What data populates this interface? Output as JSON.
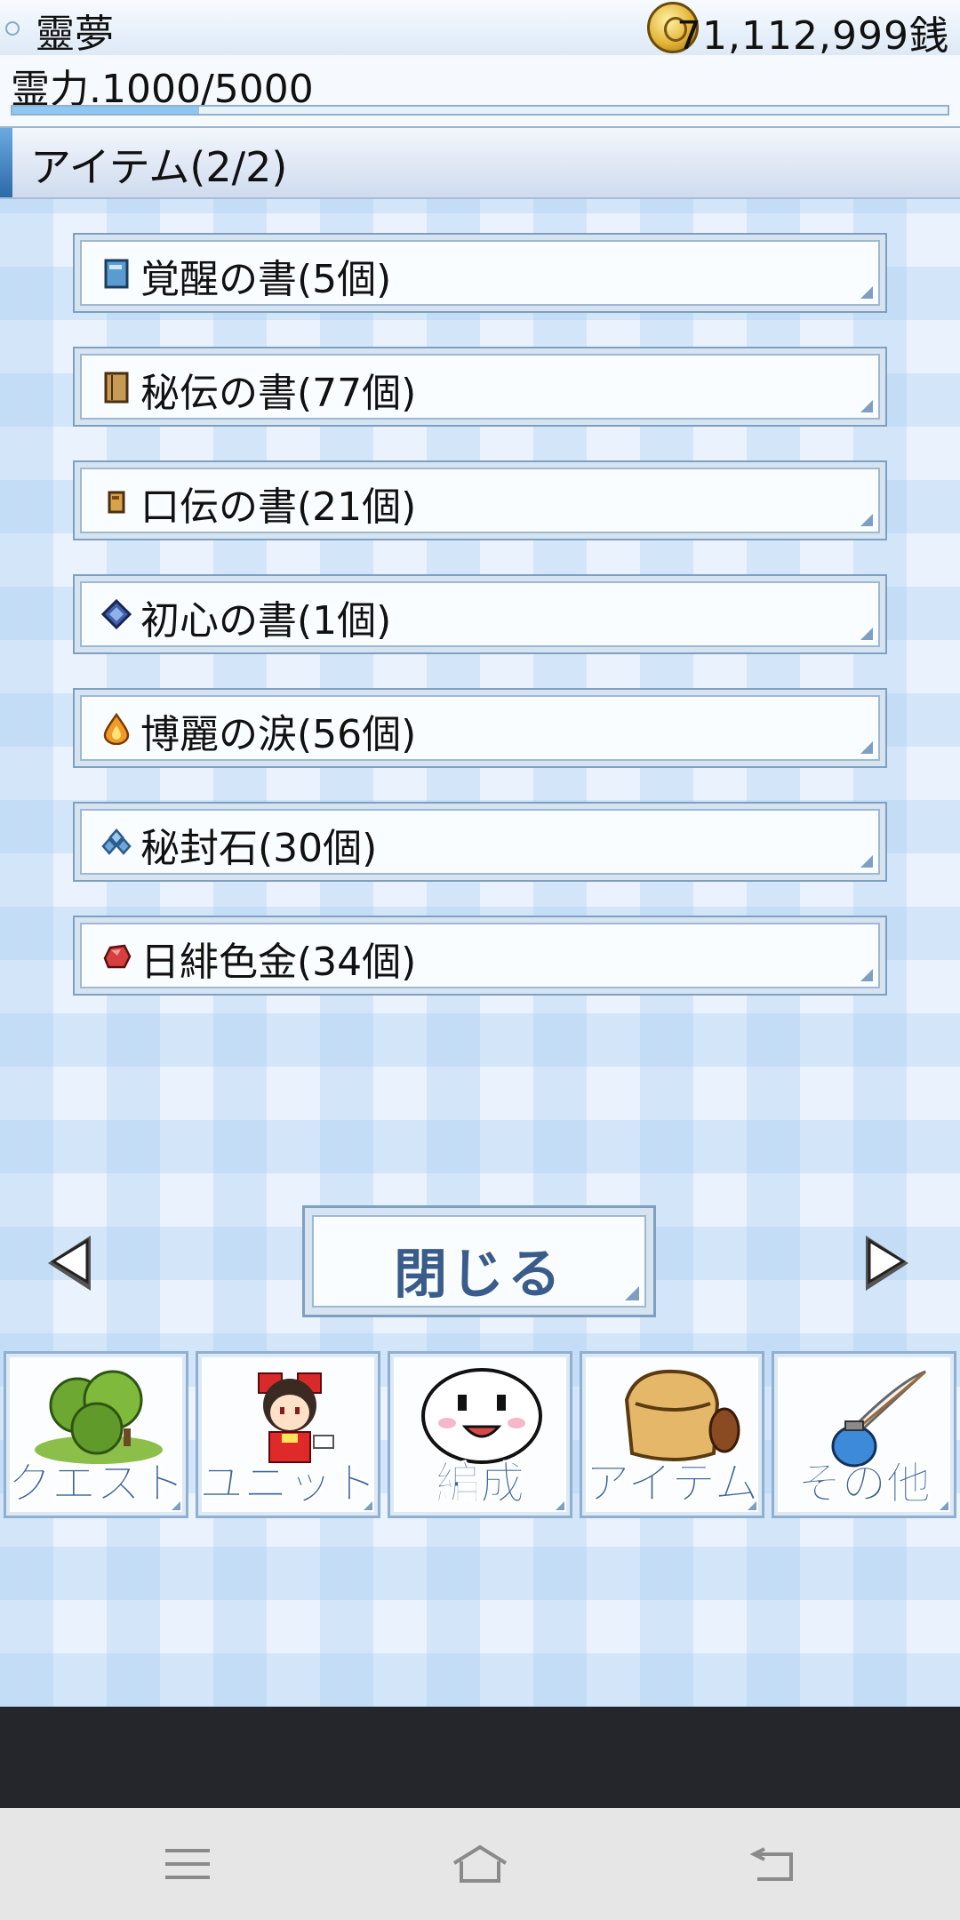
{
  "status": {
    "player_name": "靈夢",
    "money": "71,112,999銭",
    "power_label": "霊力.1000/5000",
    "power_fraction": 0.2
  },
  "screen": {
    "title": "アイテム(2/2)"
  },
  "items": [
    {
      "label": "覚醒の書(5個)",
      "icon": "blue-book-icon",
      "color": "#5b9bd0"
    },
    {
      "label": "秘伝の書(77個)",
      "icon": "brown-scroll-book-icon",
      "color": "#a3763a"
    },
    {
      "label": "口伝の書(21個)",
      "icon": "small-brown-book-icon",
      "color": "#b8803a"
    },
    {
      "label": "初心の書(1個)",
      "icon": "navy-book-icon",
      "color": "#3f5fa8"
    },
    {
      "label": "博麗の涙(56個)",
      "icon": "orange-drop-icon",
      "color": "#f09a28"
    },
    {
      "label": "秘封石(30個)",
      "icon": "blue-crystal-icon",
      "color": "#6fa6d8"
    },
    {
      "label": "日緋色金(34個)",
      "icon": "red-ore-icon",
      "color": "#d64040"
    }
  ],
  "close_button": {
    "label": "閉じる"
  },
  "menu": [
    {
      "label": "クエスト",
      "icon": "forest-icon"
    },
    {
      "label": "ユニット",
      "icon": "reimu-character-icon"
    },
    {
      "label": "編成",
      "icon": "white-blob-face-icon"
    },
    {
      "label": "アイテム",
      "icon": "bag-icon"
    },
    {
      "label": "その他",
      "icon": "quill-ink-icon"
    }
  ],
  "colors": {
    "accent_blue": "#3e6597",
    "panel_border": "#7f9fc0",
    "background": "#eaf3fd"
  }
}
